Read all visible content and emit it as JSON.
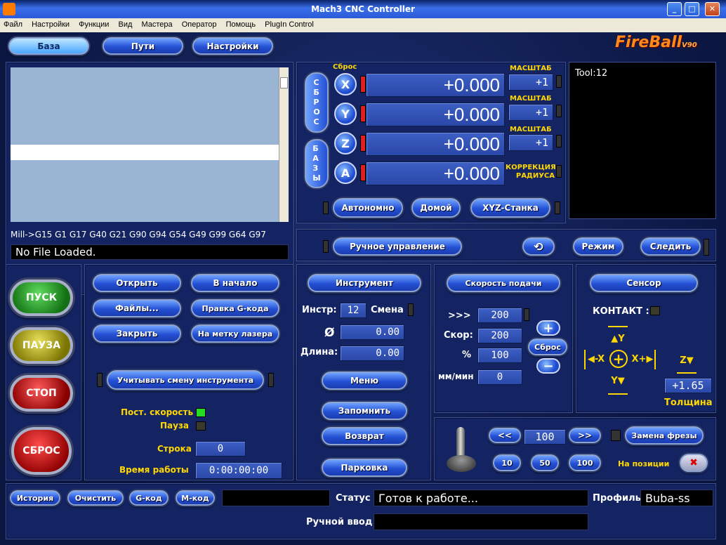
{
  "window": {
    "title": "Mach3 CNC Controller",
    "min": "_",
    "max": "□",
    "close": "✕"
  },
  "menu": [
    "Файл",
    "Настройки",
    "Функции",
    "Вид",
    "Мастера",
    "Оператор",
    "Помощь",
    "PlugIn Control"
  ],
  "tabs": {
    "base": "База",
    "paths": "Пути",
    "settings": "Настройки"
  },
  "brand": {
    "logo": "FireBall",
    "sub": "V90"
  },
  "axes": {
    "reset_label": "Сброс",
    "reset_vertical": "С\nБ\nР\nО\nС",
    "bases_vertical": "Б\nА\nЗ\nЫ",
    "rows": [
      {
        "axis": "X",
        "value": "+0.000",
        "side_label": "МАСШТАБ",
        "side_value": "+1"
      },
      {
        "axis": "Y",
        "value": "+0.000",
        "side_label": "МАСШТАБ",
        "side_value": "+1"
      },
      {
        "axis": "Z",
        "value": "+0.000",
        "side_label": "МАСШТАБ",
        "side_value": "+1"
      },
      {
        "axis": "A",
        "value": "+0.000",
        "side_label": "КОРРЕКЦИЯ РАДИУСА",
        "side_value": ""
      }
    ],
    "offline": "Автономно",
    "home": "Домой",
    "machine": "XYZ-Станка"
  },
  "tool_display": "Tool:12",
  "gcode": {
    "modal": "Mill->G15  G1 G17 G40 G21 G90 G94 G54 G49 G99 G64 G97",
    "file": "No File Loaded."
  },
  "jog": {
    "manual": "Ручное управление",
    "mode": "Режим",
    "follow": "Следить"
  },
  "controls": {
    "start": "ПУСК",
    "pause": "ПАУЗА",
    "stop": "СТОП",
    "reset": "СБРОС"
  },
  "file": {
    "open": "Открыть",
    "files": "Файлы...",
    "close": "Закрыть",
    "rewind": "В начало",
    "edit": "Правка G-кода",
    "laser": "На метку лазера",
    "tool_change": "Учитывать смену инструмента"
  },
  "status_info": {
    "css_label": "Пост. скорость",
    "pause_label": "Пауза",
    "line_label": "Строка",
    "line_value": "0",
    "runtime_label": "Время работы",
    "runtime_value": "0:00:00:00"
  },
  "tool": {
    "title": "Инструмент",
    "tool_label": "Инстр:",
    "tool_value": "12",
    "change_label": "Смена",
    "diam_label": "Ø",
    "diam_value": "0.00",
    "length_label": "Длина:",
    "length_value": "0.00",
    "menu": "Меню",
    "remember": "Запомнить",
    "return": "Возврат",
    "park": "Парковка"
  },
  "feed": {
    "title": "Скорость подачи",
    "fro_label": ">>>",
    "fro_value": "200",
    "speed_label": "Скор:",
    "speed_value": "200",
    "pct_label": "%",
    "pct_value": "100",
    "units_label": "мм/мин",
    "units_value": "0",
    "plus": "+",
    "minus": "−",
    "reset": "Сброс"
  },
  "sensor": {
    "title": "Сенсор",
    "contact": "КОНТАКТ :",
    "yplus": "Y",
    "yminus": "Y",
    "xminus": "-X",
    "xplus": "X+",
    "zminus": "Z",
    "thickness_value": "+1.65",
    "thickness_label": "Толщина"
  },
  "spindle": {
    "prev": "<<",
    "value": "100",
    "next": ">>",
    "change": "Замена фрезы",
    "s10": "10",
    "s50": "50",
    "s100": "100",
    "in_position": "На позиции",
    "cancel": "✖"
  },
  "footer": {
    "history": "История",
    "clear": "Очистить",
    "gcode": "G-код",
    "mcode": "М-код",
    "status_label": "Статус",
    "status_value": "Готов к работе...",
    "profile_label": "Профиль",
    "profile_value": "Buba-ss",
    "mdi_label": "Ручной ввод",
    "mdi_value": ""
  },
  "colors": {
    "accent": "#2450d4",
    "led_green": "#22dd22",
    "title_blue": "#0a246a"
  }
}
